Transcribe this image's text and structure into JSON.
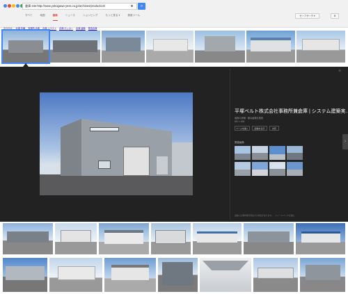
{
  "search": {
    "query": "倉庫 site:http://www.yokogawa-yess.co.jp/archives/production/"
  },
  "tabs": [
    "すべて",
    "地図",
    "画像",
    "ニュース",
    "ショッピング",
    "もっと見る ▾",
    "検索ツール"
  ],
  "safesearch_label": "セーフサーチ ▾",
  "related": {
    "label": "関連検索:",
    "items": [
      "倉庫 外観",
      "事務所 倉庫",
      "倉庫 イラスト",
      "倉庫 ロッカー",
      "倉庫 建築",
      "物流倉庫"
    ]
  },
  "preview": {
    "title": "平塚ベルト株式会社事務所兼倉庫 | システム建築実…",
    "subtitle": "画像の詳細 · 類似画像を検索",
    "size": "810 × 600",
    "buttons": [
      "ページを開く",
      "画像を表示",
      "共有"
    ],
    "related_label": "関連画像:",
    "footer": "画像には著作権が存在する場合があります。 · フィードバックの送信"
  },
  "colors": {
    "accent": "#4285f4",
    "active_tab": "#dd4b39",
    "panel_bg": "#222222"
  }
}
